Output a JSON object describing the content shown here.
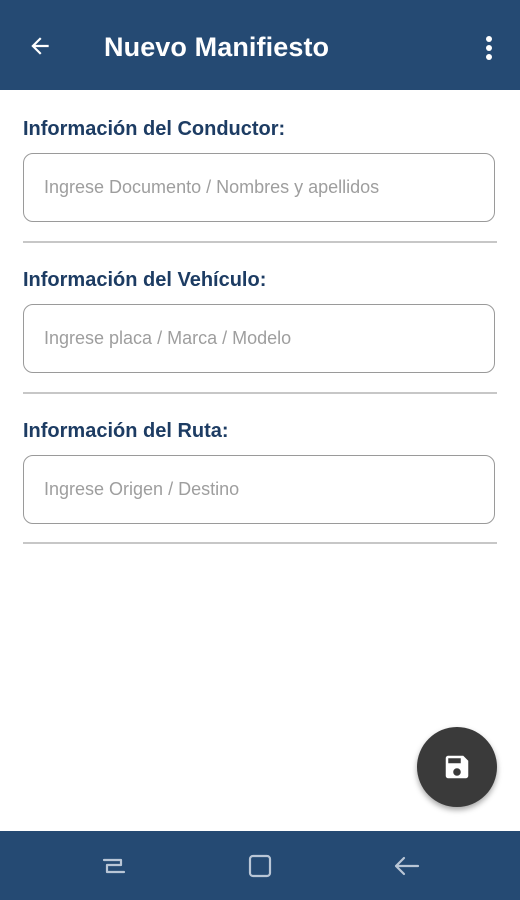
{
  "appbar": {
    "title": "Nuevo Manifiesto",
    "back_icon": "arrow-left-icon",
    "menu_icon": "more-vertical-icon"
  },
  "sections": [
    {
      "label": "Información del Conductor:",
      "placeholder": "Ingrese Documento / Nombres y apellidos",
      "value": ""
    },
    {
      "label": "Información del Vehículo:",
      "placeholder": "Ingrese placa / Marca / Modelo",
      "value": ""
    },
    {
      "label": "Información del Ruta:",
      "placeholder": "Ingrese Origen / Destino",
      "value": ""
    }
  ],
  "fab": {
    "icon": "save-icon"
  },
  "navbar": {
    "icons": [
      "recent-apps-icon",
      "home-icon",
      "back-icon"
    ]
  },
  "colors": {
    "primary": "#254a73",
    "label": "#1d3c63",
    "fab": "#3a3a3a"
  }
}
